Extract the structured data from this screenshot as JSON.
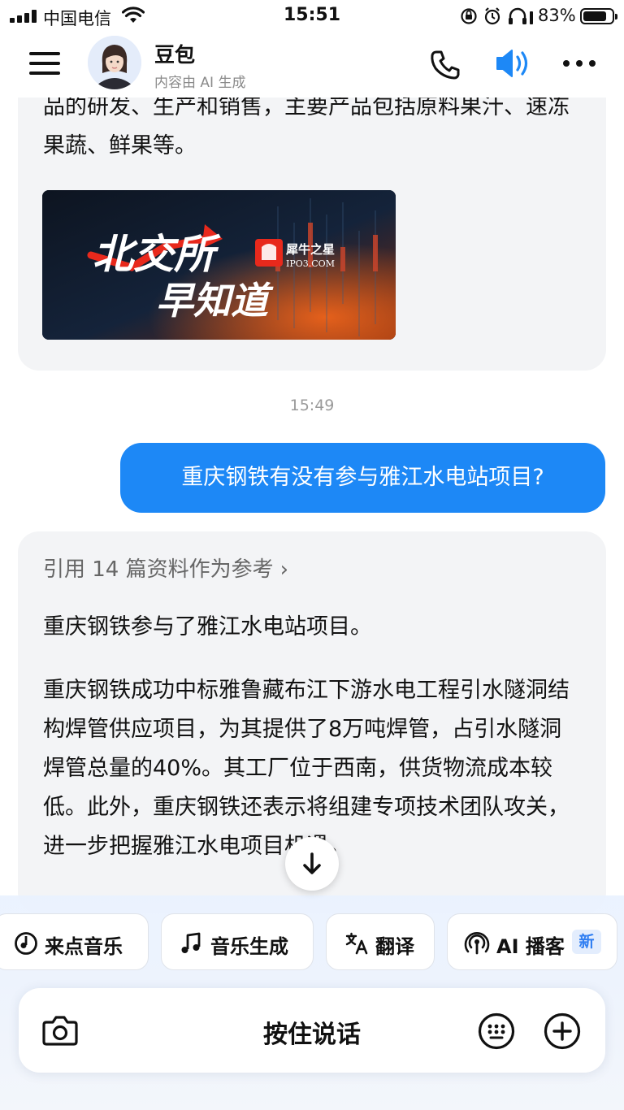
{
  "status_bar": {
    "carrier": "中国电信",
    "time": "15:51",
    "battery": "83%",
    "battery_level": 0.83
  },
  "header": {
    "bot_name": "豆包",
    "subtitle": "内容由 AI 生成",
    "icons": [
      "menu-icon",
      "phone-icon",
      "speaker-icon",
      "more-icon"
    ]
  },
  "messages": {
    "ai_prev": {
      "text": "品的研发、生产和销售，主要产品包括原料果汁、速冻果蔬、鲜果等。",
      "image": {
        "title_line1": "北交所",
        "title_line2": "早知道",
        "logo_cn": "犀牛之星",
        "logo_en": "IPO3.COM"
      }
    },
    "timestamp": "15:49",
    "user": "重庆钢铁有没有参与雅江水电站项目?",
    "ai_answer": {
      "reference": "引用 14 篇资料作为参考",
      "p1": "重庆钢铁参与了雅江水电站项目。",
      "p2": "重庆钢铁成功中标雅鲁藏布江下游水电工程引水隧洞结构焊管供应项目，为其提供了8万吨焊管，占引水隧洞焊管总量的40%。其工厂位于西南，供货物流成本较低。此外，重庆钢铁还表示将组建专项技术团队攻关，进一步把握雅江水电项目机遇。"
    }
  },
  "quick_actions": [
    {
      "label": "来点音乐",
      "icon": "music-disc-icon"
    },
    {
      "label": "音乐生成",
      "icon": "music-note-icon"
    },
    {
      "label": "翻译",
      "icon": "translate-icon"
    },
    {
      "label": "AI 播客",
      "icon": "podcast-icon",
      "badge": "新"
    }
  ],
  "input": {
    "hold_to_talk": "按住说话"
  },
  "colors": {
    "accent": "#1d88f6",
    "ai_bubble": "#f3f4f6",
    "badge": "#2f7ef2"
  }
}
